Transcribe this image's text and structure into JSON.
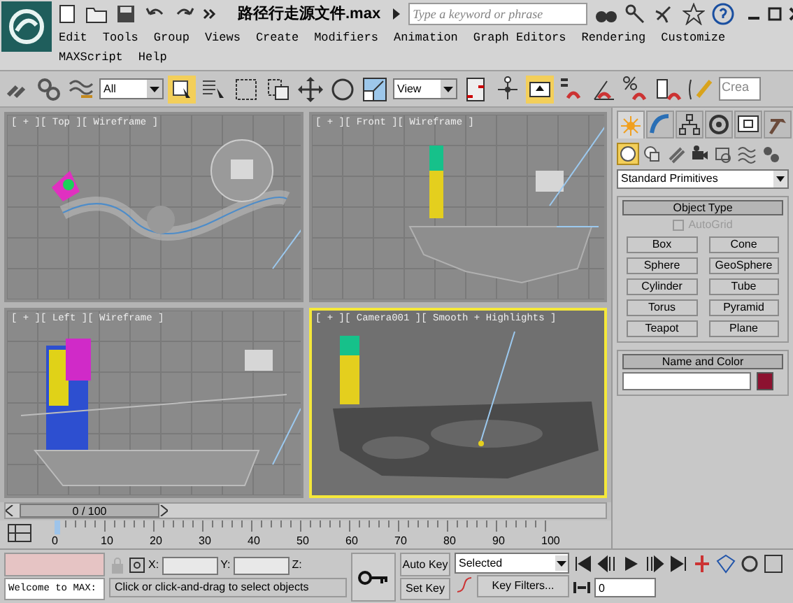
{
  "title_bar": {
    "file_title": "路径行走源文件.max",
    "search_placeholder": "Type a keyword or phrase"
  },
  "menu": [
    "Edit",
    "Tools",
    "Group",
    "Views",
    "Create",
    "Modifiers",
    "Animation",
    "Graph Editors",
    "Rendering",
    "Customize",
    "MAXScript",
    "Help"
  ],
  "toolbar": {
    "selection_filter": "All",
    "reference_coordinates": "View",
    "search_cut": "Crea"
  },
  "viewports": [
    {
      "label": "[ + ][ Top ][ Wireframe ]",
      "kind": "top",
      "selected": false
    },
    {
      "label": "[ + ][ Front ][ Wireframe ]",
      "kind": "front",
      "selected": false
    },
    {
      "label": "[ + ][ Left ][ Wireframe ]",
      "kind": "left",
      "selected": false
    },
    {
      "label": "[ + ][ Camera001 ][ Smooth + Highlights ]",
      "kind": "camera",
      "selected": true
    }
  ],
  "command_panel": {
    "tabs": [
      {
        "selected": true
      },
      {
        "selected": false
      },
      {
        "selected": false
      },
      {
        "selected": false
      },
      {
        "selected": false
      },
      {
        "selected": false
      }
    ],
    "categories": [
      {
        "selected": true
      },
      {
        "selected": false
      },
      {
        "selected": false
      },
      {
        "selected": false
      },
      {
        "selected": false
      },
      {
        "selected": false
      },
      {
        "selected": false
      }
    ],
    "subcategory": "Standard Primitives",
    "object_type": {
      "title": "Object Type",
      "autogrid": {
        "label": "AutoGrid",
        "checked": false,
        "disabled": true
      },
      "buttons": [
        "Box",
        "Cone",
        "Sphere",
        "GeoSphere",
        "Cylinder",
        "Tube",
        "Torus",
        "Pyramid",
        "Teapot",
        "Plane"
      ]
    },
    "name_and_color": {
      "title": "Name and Color",
      "color": "#8c1230"
    }
  },
  "time_slider": {
    "label": "0 / 100",
    "level": 0
  },
  "track_bar": {
    "ticks": [
      "0",
      "10",
      "20",
      "30",
      "40",
      "50",
      "60",
      "70",
      "80",
      "90",
      "100"
    ]
  },
  "status": {
    "listener": "Welcome to MAX:",
    "prompt": "Click or click-and-drag to select objects",
    "x_label": "X:",
    "y_label": "Y:",
    "z_label": "Z:",
    "auto_key": "Auto Key",
    "set_key": "Set Key",
    "key_mode": "Selected",
    "key_filters": "Key Filters...",
    "frame": "0"
  }
}
